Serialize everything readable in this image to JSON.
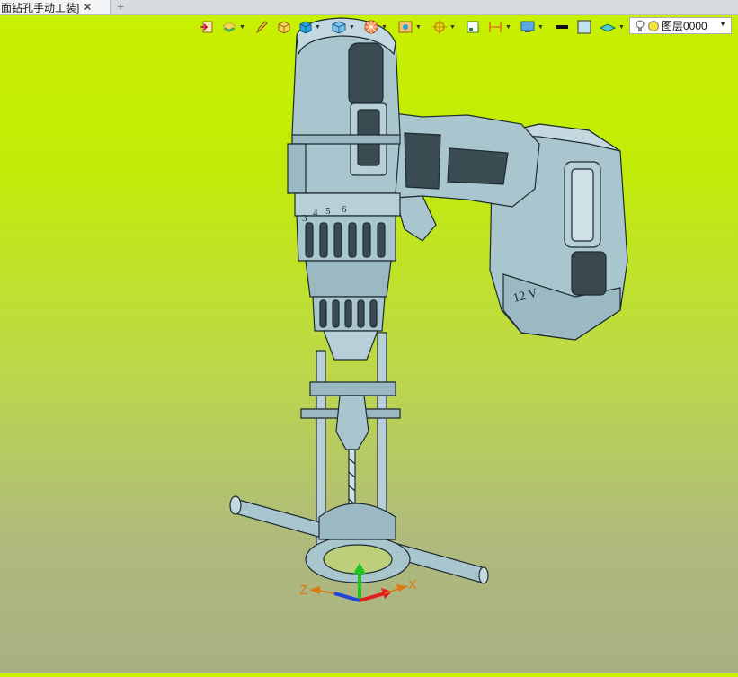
{
  "tab": {
    "title": "面钻孔手动工装]",
    "close_glyph": "✕",
    "add_glyph": "+"
  },
  "toolbar": {
    "icons": [
      "exit-sketch-icon",
      "layer-manager-icon",
      "pencil-icon",
      "part-color-icon",
      "solid-box-icon",
      "view-cube-icon",
      "render-mode-icon",
      "section-view-icon",
      "snap-icon",
      "frame-icon",
      "dimension-icon",
      "display-icon",
      "line-color-icon",
      "fill-color-icon",
      "material-icon"
    ],
    "colors": {
      "line": "#111111",
      "fill": "#bfe3ee"
    }
  },
  "layer": {
    "current": "图层0000"
  },
  "viewport": {
    "background_top": "#c9f000",
    "background_bottom": "#a8b083",
    "model_fill": "#a9c6cf",
    "model_edge": "#1d2a30"
  },
  "drill": {
    "clutch_numbers": [
      "3",
      "4",
      "5",
      "6"
    ],
    "battery_label": "12 V"
  },
  "triad": {
    "x_label": "X",
    "z_label": "Z"
  }
}
